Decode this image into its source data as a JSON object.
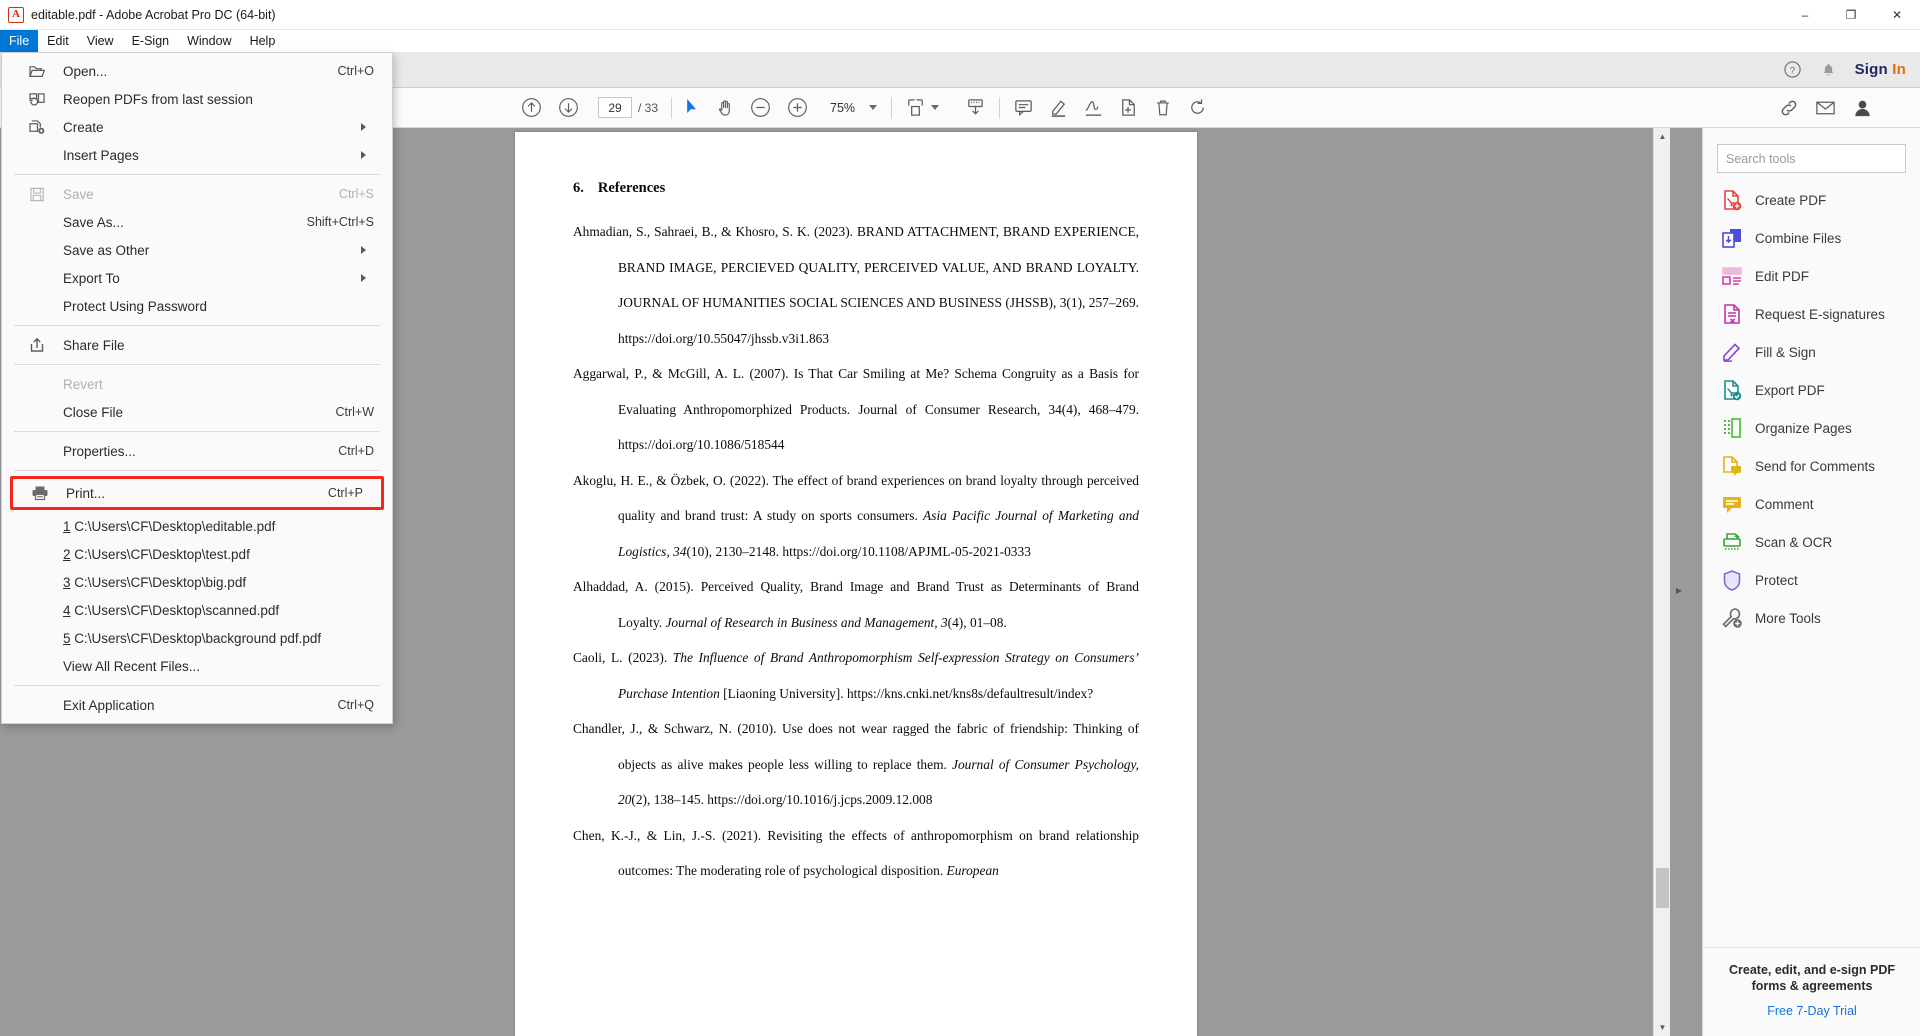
{
  "window": {
    "title": "editable.pdf - Adobe Acrobat Pro DC (64-bit)",
    "logo_glyph": "A",
    "minimize": "–",
    "maximize": "❐",
    "close": "✕"
  },
  "menubar": {
    "items": [
      {
        "label": "File",
        "active": true
      },
      {
        "label": "Edit",
        "active": false
      },
      {
        "label": "View",
        "active": false
      },
      {
        "label": "E-Sign",
        "active": false
      },
      {
        "label": "Window",
        "active": false
      },
      {
        "label": "Help",
        "active": false
      }
    ]
  },
  "appbar": {
    "help_icon": "help-circle-icon",
    "bell_icon": "notification-bell-icon",
    "sign_in": "Sign In",
    "sign_in_part1": "Sign ",
    "sign_in_part2": "In"
  },
  "toolbar": {
    "prev_page_icon": "arrow-up-circle-icon",
    "next_page_icon": "arrow-down-circle-icon",
    "page_number": "29",
    "page_total": "/ 33",
    "select_tool_icon": "cursor-arrow-icon",
    "hand_tool_icon": "hand-icon",
    "zoom_out_icon": "zoom-out-icon",
    "zoom_in_icon": "zoom-in-icon",
    "zoom_level": "75%",
    "fit_page_icon": "fit-page-icon",
    "scroll_mode_icon": "page-scroll-icon",
    "comment_icon": "comment-bubble-icon",
    "highlight_icon": "highlighter-icon",
    "draw_icon": "draw-signature-icon",
    "stamp_icon": "add-stamp-icon",
    "delete_icon": "trash-icon",
    "rotate_icon": "rotate-icon",
    "link_icon": "share-link-icon",
    "mail_icon": "email-icon",
    "account_icon": "user-account-icon"
  },
  "filemenu": {
    "groups": [
      {
        "items": [
          {
            "label": "Open...",
            "accel": "Ctrl+O",
            "icon": "folder-open-icon",
            "disabled": false,
            "submenu": false
          },
          {
            "label": "Reopen PDFs from last session",
            "accel": "",
            "icon": "reopen-pdfs-icon",
            "disabled": false,
            "submenu": false
          },
          {
            "label": "Create",
            "accel": "",
            "icon": "create-pdf-icon",
            "disabled": false,
            "submenu": true
          },
          {
            "label": "Insert Pages",
            "accel": "",
            "icon": "",
            "disabled": false,
            "submenu": true
          }
        ]
      },
      {
        "items": [
          {
            "label": "Save",
            "accel": "Ctrl+S",
            "icon": "save-disk-icon",
            "disabled": true,
            "submenu": false
          },
          {
            "label": "Save As...",
            "accel": "Shift+Ctrl+S",
            "icon": "",
            "disabled": false,
            "submenu": false
          },
          {
            "label": "Save as Other",
            "accel": "",
            "icon": "",
            "disabled": false,
            "submenu": true
          },
          {
            "label": "Export To",
            "accel": "",
            "icon": "",
            "disabled": false,
            "submenu": true
          },
          {
            "label": "Protect Using Password",
            "accel": "",
            "icon": "",
            "disabled": false,
            "submenu": false
          }
        ]
      },
      {
        "items": [
          {
            "label": "Share File",
            "accel": "",
            "icon": "share-upload-icon",
            "disabled": false,
            "submenu": false
          }
        ]
      },
      {
        "items": [
          {
            "label": "Revert",
            "accel": "",
            "icon": "",
            "disabled": true,
            "submenu": false
          },
          {
            "label": "Close File",
            "accel": "Ctrl+W",
            "icon": "",
            "disabled": false,
            "submenu": false
          }
        ]
      },
      {
        "items": [
          {
            "label": "Properties...",
            "accel": "Ctrl+D",
            "icon": "",
            "disabled": false,
            "submenu": false
          }
        ]
      }
    ],
    "print": {
      "label": "Print...",
      "accel": "Ctrl+P",
      "icon": "printer-icon",
      "highlighted": true
    },
    "recent_files": [
      {
        "num": "1",
        "path": "C:\\Users\\CF\\Desktop\\editable.pdf"
      },
      {
        "num": "2",
        "path": "C:\\Users\\CF\\Desktop\\test.pdf"
      },
      {
        "num": "3",
        "path": "C:\\Users\\CF\\Desktop\\big.pdf"
      },
      {
        "num": "4",
        "path": "C:\\Users\\CF\\Desktop\\scanned.pdf"
      },
      {
        "num": "5",
        "path": "C:\\Users\\CF\\Desktop\\background pdf.pdf"
      }
    ],
    "view_all_recent": "View All Recent Files...",
    "exit": {
      "label": "Exit Application",
      "accel": "Ctrl+Q"
    },
    "highlight_color": "#f6261d"
  },
  "tools_panel": {
    "search_placeholder": "Search tools",
    "items": [
      {
        "label": "Create PDF",
        "icon": "create-pdf-icon",
        "color": "#e8453c"
      },
      {
        "label": "Combine Files",
        "icon": "combine-files-icon",
        "color": "#4b4ddb"
      },
      {
        "label": "Edit PDF",
        "icon": "edit-pdf-icon",
        "color": "#d93ea8"
      },
      {
        "label": "Request E-signatures",
        "icon": "request-esignature-icon",
        "color": "#c235a8"
      },
      {
        "label": "Fill & Sign",
        "icon": "fill-and-sign-icon",
        "color": "#8d3fd6"
      },
      {
        "label": "Export PDF",
        "icon": "export-pdf-icon",
        "color": "#1a8f8f"
      },
      {
        "label": "Organize Pages",
        "icon": "organize-pages-icon",
        "color": "#4fbf3f"
      },
      {
        "label": "Send for Comments",
        "icon": "send-for-comments-icon",
        "color": "#e3b417"
      },
      {
        "label": "Comment",
        "icon": "comment-icon",
        "color": "#e3b417"
      },
      {
        "label": "Scan & OCR",
        "icon": "scan-ocr-icon",
        "color": "#3aa33a"
      },
      {
        "label": "Protect",
        "icon": "protect-shield-icon",
        "color": "#7b6ad6"
      },
      {
        "label": "More Tools",
        "icon": "more-tools-icon",
        "color": "#6b6b6b"
      }
    ],
    "promo_title": "Create, edit, and e-sign PDF forms & agreements",
    "promo_link": "Free 7-Day Trial"
  },
  "document": {
    "section_number": "6.",
    "section_title": "References",
    "references": [
      {
        "parts": [
          {
            "t": "Ahmadian, S., Sahraei, B., & Khosro, S. K. (2023). BRAND ATTACHMENT, BRAND EXPERIENCE, BRAND IMAGE, PERCIEVED QUALITY, PERCEIVED VALUE, AND BRAND LOYALTY. JOURNAL OF HUMANITIES SOCIAL SCIENCES AND BUSINESS (JHSSB), 3(1), 257–269. https://doi.org/10.55047/jhssb.v3i1.863",
            "i": false
          }
        ]
      },
      {
        "parts": [
          {
            "t": "Aggarwal, P., & McGill, A. L. (2007). Is That Car Smiling at Me? Schema Congruity as a Basis for Evaluating Anthropomorphized Products. Journal of Consumer Research, 34(4), 468–479. https://doi.org/10.1086/518544",
            "i": false
          }
        ]
      },
      {
        "parts": [
          {
            "t": "Akoglu, H. E., & Özbek, O. (2022). The effect of brand experiences on brand loyalty through perceived quality and brand trust: A study on sports consumers. ",
            "i": false
          },
          {
            "t": "Asia Pacific Journal of Marketing and Logistics, 34",
            "i": true
          },
          {
            "t": "(10), 2130–2148. https://doi.org/10.1108/APJML-05-2021-0333",
            "i": false
          }
        ]
      },
      {
        "parts": [
          {
            "t": "Alhaddad, A. (2015). Perceived Quality, Brand Image and Brand Trust as Determinants of Brand Loyalty. ",
            "i": false
          },
          {
            "t": "Journal of Research in Business and Management, 3",
            "i": true
          },
          {
            "t": "(4), 01–08.",
            "i": false
          }
        ]
      },
      {
        "parts": [
          {
            "t": "Caoli, L. (2023). ",
            "i": false
          },
          {
            "t": "The Influence of Brand Anthropomorphism Self-expression Strategy on Consumers’ Purchase Intention",
            "i": true
          },
          {
            "t": " [Liaoning University]. https://kns.cnki.net/kns8s/defaultresult/index?",
            "i": false
          }
        ]
      },
      {
        "parts": [
          {
            "t": "Chandler, J., & Schwarz, N. (2010). Use does not wear ragged the fabric of friendship: Thinking of objects as alive makes people less willing to replace them. ",
            "i": false
          },
          {
            "t": "Journal of Consumer Psychology, 20",
            "i": true
          },
          {
            "t": "(2), 138–145. https://doi.org/10.1016/j.jcps.2009.12.008",
            "i": false
          }
        ]
      },
      {
        "parts": [
          {
            "t": "Chen, K.-J., & Lin, J.-S. (2021). Revisiting the effects of anthropomorphism on brand relationship outcomes: The moderating role of psychological disposition. ",
            "i": false
          },
          {
            "t": "European",
            "i": true
          }
        ]
      }
    ]
  }
}
